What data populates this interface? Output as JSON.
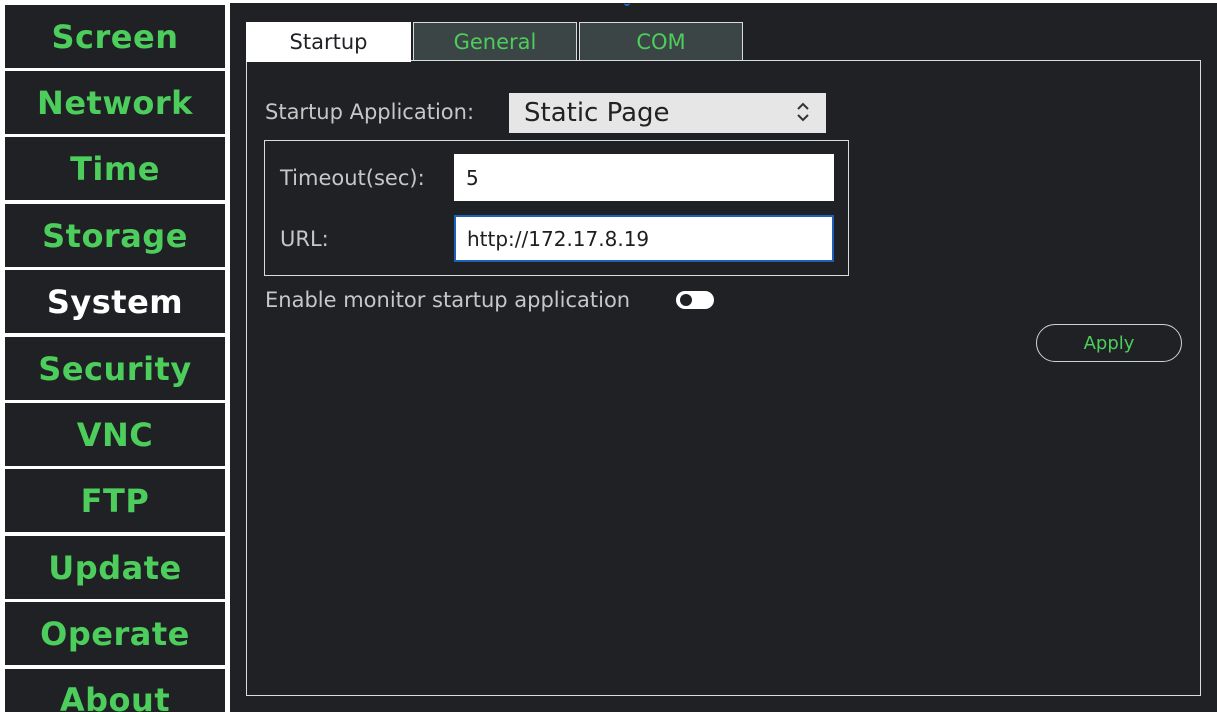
{
  "sidebar": {
    "items": [
      {
        "label": "Screen"
      },
      {
        "label": "Network"
      },
      {
        "label": "Time"
      },
      {
        "label": "Storage"
      },
      {
        "label": "System",
        "active": true
      },
      {
        "label": "Security"
      },
      {
        "label": "VNC"
      },
      {
        "label": "FTP"
      },
      {
        "label": "Update"
      },
      {
        "label": "Operate"
      },
      {
        "label": "About"
      }
    ]
  },
  "tabs": [
    {
      "label": "Startup",
      "active": true
    },
    {
      "label": "General"
    },
    {
      "label": "COM"
    }
  ],
  "startup": {
    "app_label": "Startup Application:",
    "app_value": "Static Page",
    "timeout_label": "Timeout(sec):",
    "timeout_value": "5",
    "url_label": "URL:",
    "url_value": "http://172.17.8.19",
    "monitor_label": "Enable monitor startup application",
    "monitor_enabled": false,
    "apply_label": "Apply"
  },
  "colors": {
    "background": "#1f2124",
    "accent_green": "#4ccd5c",
    "focus_blue": "#1e5fb8",
    "tab_inactive": "#3c4545"
  }
}
